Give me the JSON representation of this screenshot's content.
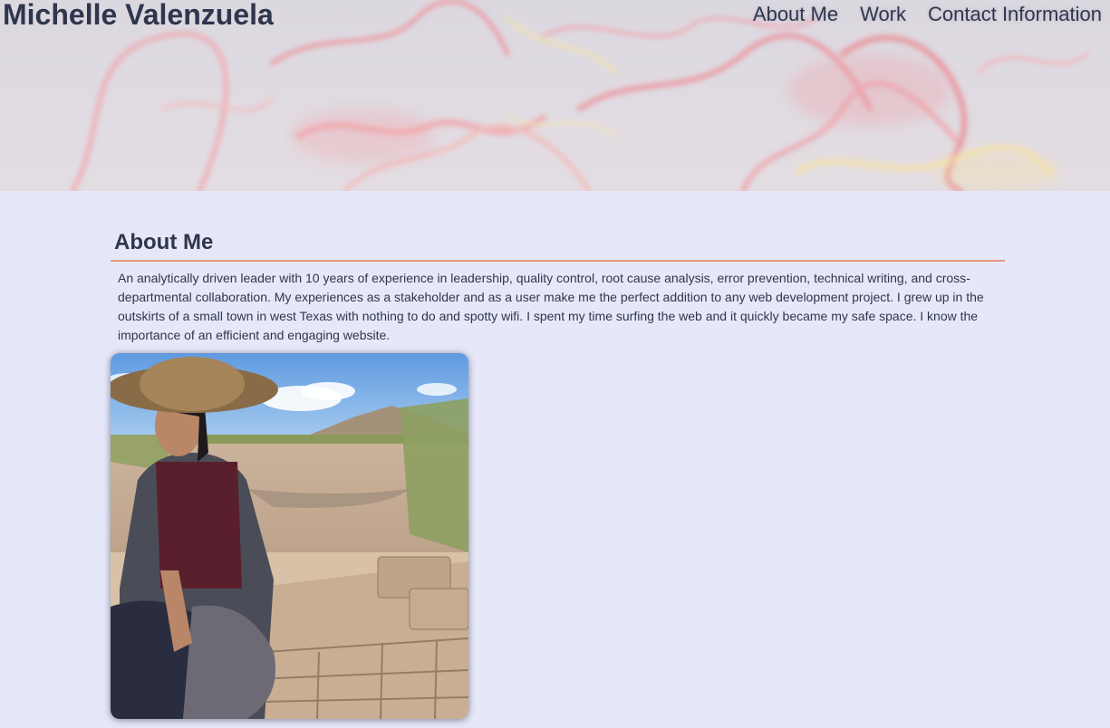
{
  "header": {
    "title": "Michelle Valenzuela",
    "nav": [
      {
        "label": "About Me"
      },
      {
        "label": "Work"
      },
      {
        "label": "Contact Information"
      }
    ]
  },
  "about": {
    "heading": "About Me",
    "text": "An analytically driven leader with 10 years of experience in leadership, quality control, root cause analysis, error prevention, technical writing, and cross-departmental collaboration. My experiences as a stakeholder and as a user make me the perfect addition to any web development project. I grew up in the outskirts of a small town in west Texas with nothing to do and spotty wifi. I spent my time surfing the web and it quickly became my safe space. I know the importance of an efficient and engaging website."
  },
  "colors": {
    "background": "#e6e8fa",
    "text": "#2f364d",
    "accent_rule": "#e59a7a"
  }
}
